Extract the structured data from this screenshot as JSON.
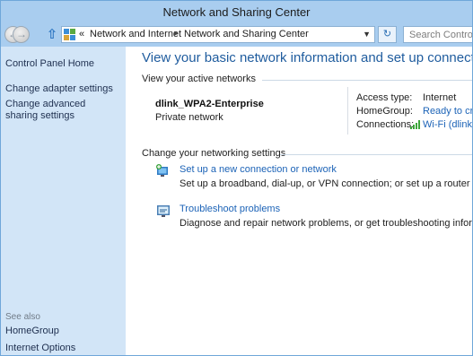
{
  "window": {
    "title": "Network and Sharing Center"
  },
  "address_bar": {
    "overflow": "«",
    "segments": [
      "Network and Internet",
      "Network and Sharing Center"
    ],
    "search_placeholder": "Search Control P"
  },
  "left_pane": {
    "links": [
      "Control Panel Home",
      "Change adapter settings",
      "Change advanced sharing settings"
    ],
    "see_also_title": "See also",
    "see_also": [
      "HomeGroup",
      "Internet Options"
    ]
  },
  "main": {
    "heading": "View your basic network information and set up connections",
    "active_networks_title": "View your active networks",
    "network": {
      "name": "dlink_WPA2-Enterprise",
      "type": "Private network",
      "access_type_label": "Access type:",
      "access_type": "Internet",
      "homegroup_label": "HomeGroup:",
      "homegroup": "Ready to crea",
      "connections_label": "Connections:",
      "connection": "Wi-Fi (dlink_V"
    },
    "settings_title": "Change your networking settings",
    "tasks": [
      {
        "link": "Set up a new connection or network",
        "description": "Set up a broadband, dial-up, or VPN connection; or set up a router or access po",
        "icon": "new-connection-icon"
      },
      {
        "link": "Troubleshoot problems",
        "description": "Diagnose and repair network problems, or get troubleshooting information.",
        "icon": "troubleshoot-icon"
      }
    ]
  },
  "colors": {
    "title_bar": "#a9cdef",
    "left_pane": "#d2e5f7",
    "heading": "#1f5c9e",
    "link": "#1c63b7"
  }
}
